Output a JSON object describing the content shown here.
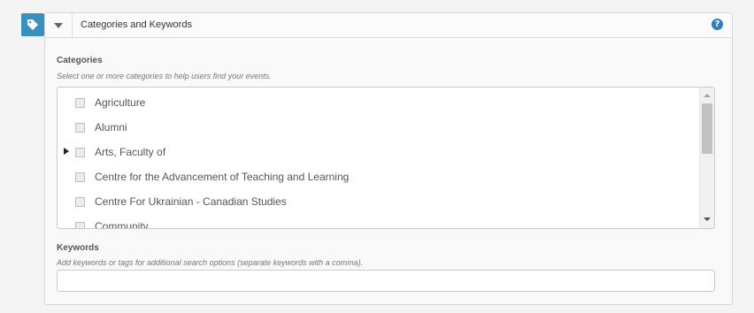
{
  "panel": {
    "title": "Categories and Keywords",
    "tag_icon": "tag-icon",
    "toggle_icon": "caret-down-icon",
    "help_icon": "?",
    "accent_color": "#3a8fc1"
  },
  "categories": {
    "label": "Categories",
    "hint": "Select one or more categories to help users find your events.",
    "items": [
      {
        "label": "Agriculture",
        "checked": false,
        "expandable": false
      },
      {
        "label": "Alumni",
        "checked": false,
        "expandable": false
      },
      {
        "label": "Arts, Faculty of",
        "checked": false,
        "expandable": true
      },
      {
        "label": "Centre for the Advancement of Teaching and Learning",
        "checked": false,
        "expandable": false
      },
      {
        "label": "Centre For Ukrainian - Canadian Studies",
        "checked": false,
        "expandable": false
      },
      {
        "label": "Community",
        "checked": false,
        "expandable": false
      }
    ]
  },
  "keywords": {
    "label": "Keywords",
    "hint": "Add keywords or tags for additional search options (separate keywords with a comma).",
    "value": "",
    "placeholder": ""
  }
}
